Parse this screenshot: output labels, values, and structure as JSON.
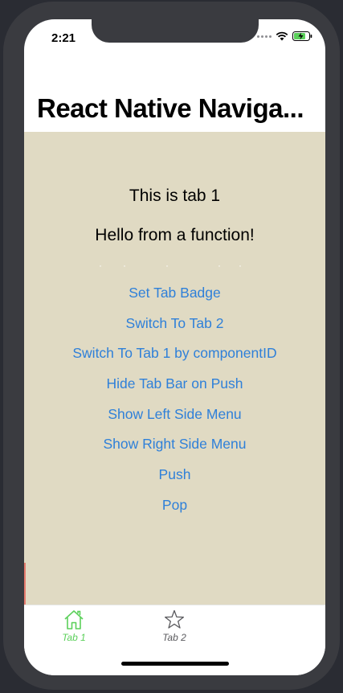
{
  "status_bar": {
    "time": "2:21"
  },
  "nav": {
    "title": "React Native Naviga..."
  },
  "content": {
    "line1": "This is tab 1",
    "line2": "Hello from a function!",
    "buttons": [
      "Set Tab Badge",
      "Switch To Tab 2",
      "Switch To Tab 1 by componentID",
      "Hide Tab Bar on Push",
      "Show Left Side Menu",
      "Show Right Side Menu",
      "Push",
      "Pop"
    ]
  },
  "tabbar": {
    "tabs": [
      {
        "label": "Tab 1",
        "icon": "home-icon",
        "selected": true
      },
      {
        "label": "Tab 2",
        "icon": "star-icon",
        "selected": false
      }
    ]
  },
  "colors": {
    "content_bg": "#e0dac3",
    "link": "#2f80d9",
    "tab_selected": "#5bd05a",
    "tab_unselected": "#5a5a5e"
  }
}
